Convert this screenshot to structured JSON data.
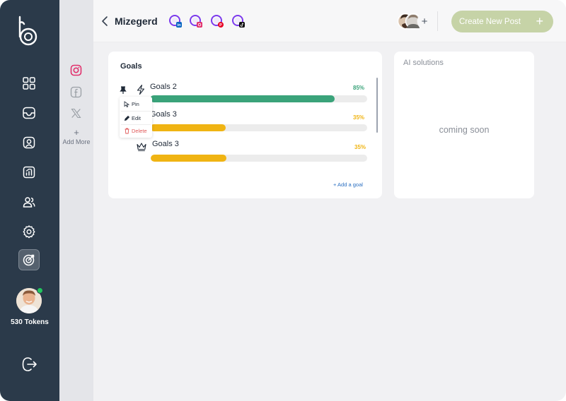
{
  "nav": {
    "items": [
      {
        "icon": "grid-icon"
      },
      {
        "icon": "inbox-icon"
      },
      {
        "icon": "contact-icon"
      },
      {
        "icon": "analytics-icon"
      },
      {
        "icon": "users-icon"
      },
      {
        "icon": "settings-icon"
      },
      {
        "icon": "target-icon",
        "active": true
      }
    ],
    "tokens": "530 Tokens"
  },
  "social": {
    "items": [
      "instagram-icon",
      "facebook-icon",
      "x-icon"
    ],
    "add_plus": "+",
    "add_more": "Add More"
  },
  "header": {
    "title": "Mizegerd",
    "accounts": [
      {
        "badge": "linkedin-icon",
        "color": "#0a66c2"
      },
      {
        "badge": "instagram-icon",
        "color": "#e1306c"
      },
      {
        "badge": "pinterest-icon",
        "color": "#e60023"
      },
      {
        "badge": "tiktok-icon",
        "color": "#111111"
      }
    ],
    "team_add": "+",
    "create_button": "Create New Post",
    "create_plus": "+"
  },
  "goals": {
    "title": "Goals",
    "items": [
      {
        "label": "Goals 2",
        "percent_text": "85%",
        "percent": 85,
        "color": "#3aa37a"
      },
      {
        "label": "Goals 3",
        "percent_text": "35%",
        "percent": 35,
        "color": "#f0b413"
      },
      {
        "label": "Goals 3",
        "percent_text": "35%",
        "percent": 35,
        "color": "#f0b413"
      }
    ],
    "add_goal": "+ Add a goal",
    "menu": {
      "pin": "Pin",
      "edit": "Edit",
      "delete": "Delete"
    }
  },
  "ai": {
    "title": "AI solutions",
    "status": "coming soon"
  }
}
